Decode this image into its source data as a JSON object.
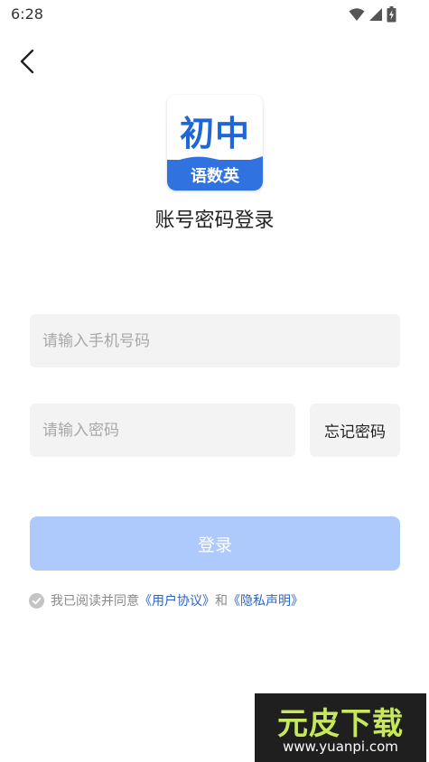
{
  "status_bar": {
    "time": "6:28",
    "icons": [
      "wifi-icon",
      "signal-icon",
      "battery-charging-icon"
    ]
  },
  "nav": {
    "back_icon": "chevron-left-icon"
  },
  "logo": {
    "top_text": "初中",
    "bottom_text": "语数英",
    "colors": {
      "primary": "#1f66d6",
      "band": "#2f72e0"
    }
  },
  "page": {
    "title": "账号密码登录"
  },
  "form": {
    "phone_placeholder": "请输入手机号码",
    "phone_value": "",
    "password_placeholder": "请输入密码",
    "password_value": "",
    "forgot_label": "忘记密码",
    "login_label": "登录",
    "login_color": "#aec9fb"
  },
  "agreement": {
    "prefix": "我已阅读并同意",
    "user_agreement": "《用户协议》",
    "conjunction": "和",
    "privacy_statement": "《隐私声明》",
    "link_color": "#2a64c8"
  },
  "watermark": {
    "main": "元皮下载",
    "url": "www.yuanpi.com"
  }
}
